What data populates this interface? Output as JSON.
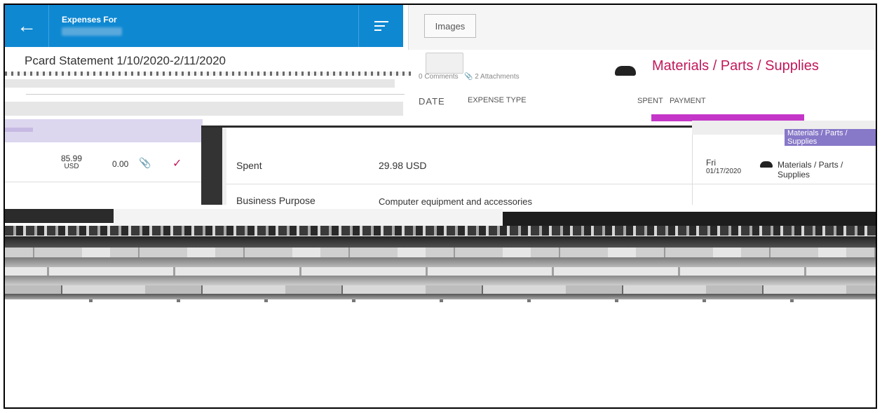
{
  "header": {
    "back_icon": "arrow-left-icon",
    "title": "Expenses For",
    "filter_icon": "filter-icon"
  },
  "statement": {
    "title": "Pcard Statement 1/10/2020-2/11/2020"
  },
  "expense_row": {
    "amount": "85.99",
    "currency": "USD",
    "percent": "0.00",
    "attachment_icon": "paperclip-icon",
    "status_icon": "checkmark-icon"
  },
  "detail": {
    "spent_label": "Spent",
    "spent_value": "29.98 USD",
    "business_purpose_label": "Business Purpose",
    "business_purpose_value": "Computer equipment and accessories"
  },
  "right_panel": {
    "images_button": "Images",
    "category_title": "Materials / Parts / Supplies",
    "comments": "0 Comments",
    "attachments": "2 Attachments",
    "col_date": "DATE",
    "col_expense": "EXPENSE TYPE",
    "col_spent": "SPENT",
    "col_payment": "PAYMENT",
    "row": {
      "day": "Fri",
      "date": "01/17/2020",
      "category": "Materials / Parts / Supplies"
    }
  },
  "colors": {
    "header_blue": "#0f88d2",
    "accent_magenta": "#c2185b",
    "lavender": "#dcd6ef"
  }
}
